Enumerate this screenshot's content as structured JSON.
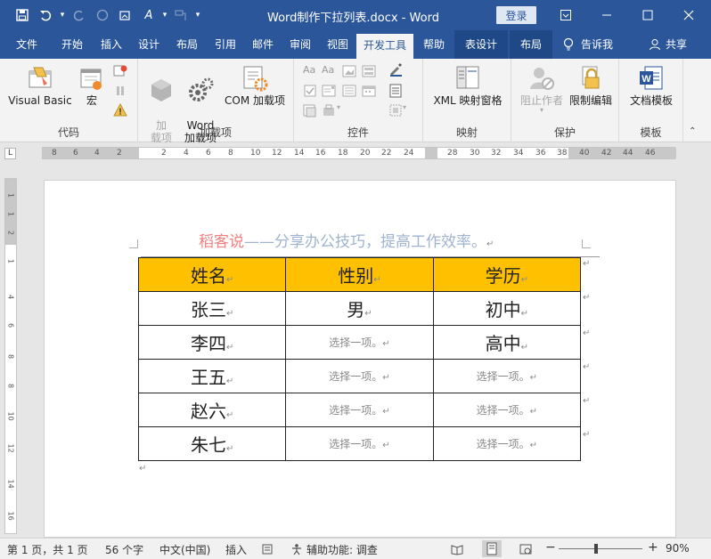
{
  "window": {
    "title": "Word制作下拉列表.docx  -  Word",
    "login_label": "登录"
  },
  "tabs": [
    {
      "label": "文件"
    },
    {
      "label": "开始"
    },
    {
      "label": "插入"
    },
    {
      "label": "设计"
    },
    {
      "label": "布局"
    },
    {
      "label": "引用"
    },
    {
      "label": "邮件"
    },
    {
      "label": "审阅"
    },
    {
      "label": "视图"
    },
    {
      "label": "开发工具"
    },
    {
      "label": "帮助"
    },
    {
      "label": "表设计"
    },
    {
      "label": "布局"
    }
  ],
  "tell_me": "告诉我",
  "share": "共享",
  "ribbon": {
    "groups": [
      {
        "label": "代码",
        "buttons": [
          "Visual Basic",
          "宏"
        ]
      },
      {
        "label": "加载项",
        "buttons": [
          "加\n载项",
          "Word\n加载项",
          "COM 加载项"
        ]
      },
      {
        "label": "控件"
      },
      {
        "label": "映射",
        "buttons": [
          "XML 映射窗格"
        ]
      },
      {
        "label": "保护",
        "buttons": [
          "阻止作者",
          "限制编辑"
        ]
      },
      {
        "label": "模板",
        "buttons": [
          "文档模板"
        ]
      }
    ]
  },
  "ruler": {
    "h_numbers": [
      "8",
      "6",
      "4",
      "2",
      "2",
      "4",
      "6",
      "8",
      "10",
      "12",
      "14",
      "16",
      "18",
      "20",
      "22",
      "24",
      "28",
      "30",
      "32",
      "34",
      "36",
      "38",
      "40",
      "42",
      "44",
      "46"
    ],
    "v_numbers": [
      "1",
      "1",
      "2",
      "1",
      "4",
      "6",
      "8",
      "8",
      "10",
      "12",
      "14",
      "16"
    ]
  },
  "document": {
    "header_red": "稻客说",
    "header_blue": "——分享办公技巧，提高工作效率。",
    "table": {
      "headers": [
        "姓名",
        "性别",
        "学历"
      ],
      "rows": [
        [
          "张三",
          "男",
          "初中"
        ],
        [
          "李四",
          "选择一项。",
          "高中"
        ],
        [
          "王五",
          "选择一项。",
          "选择一项。"
        ],
        [
          "赵六",
          "选择一项。",
          "选择一项。"
        ],
        [
          "朱七",
          "选择一项。",
          "选择一项。"
        ]
      ]
    }
  },
  "status": {
    "page": "第 1 页，共 1 页",
    "words": "56 个字",
    "language": "中文(中国)",
    "mode": "插入",
    "accessibility": "辅助功能: 调查",
    "zoom": "90%",
    "zoom_value": 90
  },
  "colors": {
    "brand": "#2b579a",
    "table_header": "#ffc000",
    "header_red": "#f08080",
    "header_blue": "#9fb3cf"
  }
}
